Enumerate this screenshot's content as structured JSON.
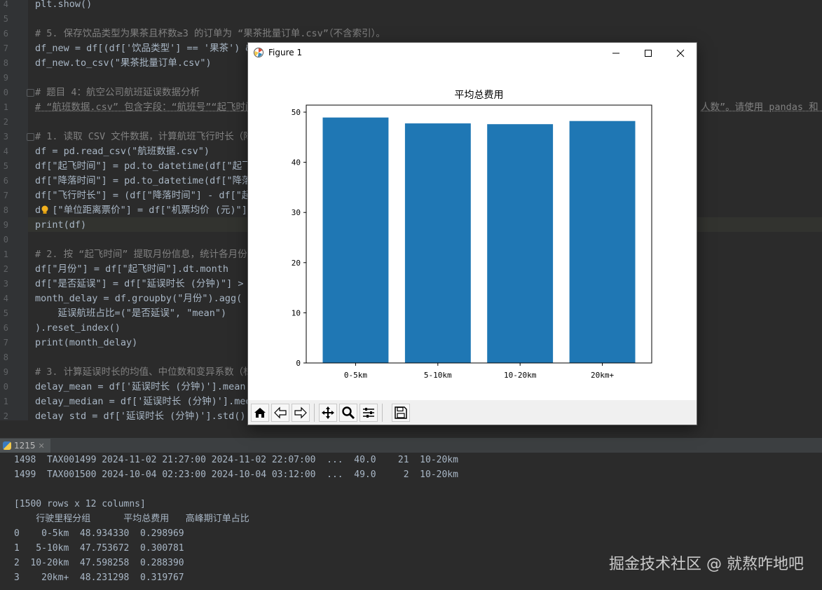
{
  "editor": {
    "line_numbers": [
      "4",
      "5",
      "6",
      "7",
      "8",
      "9",
      "0",
      "1",
      "2",
      "3",
      "4",
      "5",
      "6",
      "7",
      "8",
      "9",
      "0",
      "1",
      "2",
      "3",
      "4",
      "5",
      "6",
      "7",
      "8",
      "9",
      "0",
      "1",
      "2"
    ],
    "lines": [
      {
        "text": "plt.show()",
        "cls": ""
      },
      {
        "text": "",
        "cls": ""
      },
      {
        "text": "# 5. 保存饮品类型为果茶且杯数≥3 的订单为 “果茶批量订单.csv”（不含索引）。",
        "cls": "comment"
      },
      {
        "text": "df_new = df[(df['饮品类型'] == '果茶') &",
        "cls": ""
      },
      {
        "text": "df_new.to_csv(\"果茶批量订单.csv\")",
        "cls": ""
      },
      {
        "text": "",
        "cls": ""
      },
      {
        "text": "# 题目 4：航空公司航班延误数据分析",
        "cls": "comment"
      },
      {
        "text": "# “航班数据.csv” 包含字段：“航班号”“起飞时间",
        "cls": "comment-u"
      },
      {
        "text": "",
        "cls": ""
      },
      {
        "text": "# 1. 读取 CSV 文件数据，计算航班飞行时长（降",
        "cls": "comment"
      },
      {
        "text": "df = pd.read_csv(\"航班数据.csv\")",
        "cls": ""
      },
      {
        "text": "df[\"起飞时间\"] = pd.to_datetime(df[\"起飞",
        "cls": ""
      },
      {
        "text": "df[\"降落时间\"] = pd.to_datetime(df[\"降落",
        "cls": ""
      },
      {
        "text": "df[\"飞行时长\"] = (df[\"降落时间\"] - df[\"起",
        "cls": ""
      },
      {
        "text": "d  [\"单位距离票价\"] = df[\"机票均价 (元)\"] /",
        "cls": ""
      },
      {
        "text": "print(df)",
        "cls": ""
      },
      {
        "text": "",
        "cls": ""
      },
      {
        "text": "# 2. 按 “起飞时间” 提取月份信息，统计各月份的",
        "cls": "comment"
      },
      {
        "text": "df[\"月份\"] = df[\"起飞时间\"].dt.month",
        "cls": ""
      },
      {
        "text": "df[\"是否延误\"] = df[\"延误时长 (分钟)\"] > 0",
        "cls": ""
      },
      {
        "text": "month_delay = df.groupby(\"月份\").agg(",
        "cls": ""
      },
      {
        "text": "    延误航班占比=(\"是否延误\", \"mean\")",
        "cls": ""
      },
      {
        "text": ").reset_index()",
        "cls": ""
      },
      {
        "text": "print(month_delay)",
        "cls": ""
      },
      {
        "text": "",
        "cls": ""
      },
      {
        "text": "# 3. 计算延误时长的均值、中位数和变异系数（标",
        "cls": "comment"
      },
      {
        "text": "delay_mean = df['延误时长 (分钟)'].mean(",
        "cls": ""
      },
      {
        "text": "delay_median = df['延误时长 (分钟)'].med",
        "cls": ""
      },
      {
        "text": "delay_std = df['延误时长 (分钟)'].std()",
        "cls": ""
      }
    ],
    "right_overflow_text": "人数”。请使用 pandas 和 ma"
  },
  "run_tab": {
    "label": "1215",
    "close": "✕"
  },
  "console": {
    "lines": [
      "1498  TAX001499 2024-11-02 21:27:00 2024-11-02 22:07:00  ...  40.0    21  10-20km",
      "1499  TAX001500 2024-10-04 02:23:00 2024-10-04 03:12:00  ...  49.0     2  10-20km",
      "",
      "[1500 rows x 12 columns]",
      "    行驶里程分组      平均总费用   高峰期订单占比",
      "0    0-5km  48.934330  0.298969",
      "1   5-10km  47.753672  0.300781",
      "2  10-20km  47.598258  0.288390",
      "3    20km+  48.231298  0.319767"
    ]
  },
  "watermark": "掘金技术社区 @ 就熬咋地吧",
  "figure_window": {
    "title": "Figure 1",
    "minimize": "—",
    "maximize": "☐",
    "close": "✕"
  },
  "toolbar_icons": [
    "home-icon",
    "back-arrow-icon",
    "forward-arrow-icon",
    "pan-icon",
    "zoom-icon",
    "configure-subplots-icon",
    "save-icon"
  ],
  "chart_data": {
    "type": "bar",
    "title": "平均总费用",
    "categories": [
      "0-5km",
      "5-10km",
      "10-20km",
      "20km+"
    ],
    "values": [
      48.93433,
      47.753672,
      47.598258,
      48.231298
    ],
    "ylim": [
      0,
      51.4
    ],
    "yticks": [
      0,
      10,
      20,
      30,
      40,
      50
    ],
    "xlabel": "",
    "ylabel": "",
    "bar_color": "#1f77b4",
    "grid": false
  }
}
